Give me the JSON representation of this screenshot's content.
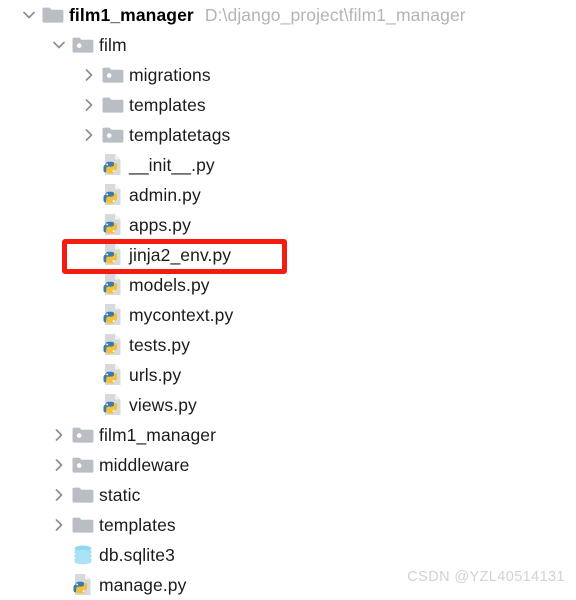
{
  "root": {
    "title": "film1_manager",
    "path": "D:\\django_project\\film1_manager"
  },
  "watermark": "CSDN @YZL40514131",
  "highlight": {
    "target": "jinja2_env.py",
    "color": "#f61b10"
  },
  "tree": [
    {
      "label": "film1_manager",
      "path": "D:\\django_project\\film1_manager",
      "icon": "folder-plain",
      "chevron": "chevron-down",
      "level": 0,
      "bold": true
    },
    {
      "label": "film",
      "icon": "folder-package",
      "chevron": "chevron-down",
      "level": 1,
      "bold": false
    },
    {
      "label": "migrations",
      "icon": "folder-package",
      "chevron": "chevron-right",
      "level": 2,
      "bold": false
    },
    {
      "label": "templates",
      "icon": "folder-plain",
      "chevron": "chevron-right",
      "level": 2,
      "bold": false
    },
    {
      "label": "templatetags",
      "icon": "folder-package",
      "chevron": "chevron-right",
      "level": 2,
      "bold": false
    },
    {
      "label": "__init__.py",
      "icon": "python-file",
      "chevron": "none",
      "level": 2,
      "bold": false
    },
    {
      "label": "admin.py",
      "icon": "python-file",
      "chevron": "none",
      "level": 2,
      "bold": false
    },
    {
      "label": "apps.py",
      "icon": "python-file",
      "chevron": "none",
      "level": 2,
      "bold": false
    },
    {
      "label": "jinja2_env.py",
      "icon": "python-file",
      "chevron": "none",
      "level": 2,
      "bold": false
    },
    {
      "label": "models.py",
      "icon": "python-file",
      "chevron": "none",
      "level": 2,
      "bold": false
    },
    {
      "label": "mycontext.py",
      "icon": "python-file",
      "chevron": "none",
      "level": 2,
      "bold": false
    },
    {
      "label": "tests.py",
      "icon": "python-file",
      "chevron": "none",
      "level": 2,
      "bold": false
    },
    {
      "label": "urls.py",
      "icon": "python-file",
      "chevron": "none",
      "level": 2,
      "bold": false
    },
    {
      "label": "views.py",
      "icon": "python-file",
      "chevron": "none",
      "level": 2,
      "bold": false
    },
    {
      "label": "film1_manager",
      "icon": "folder-package",
      "chevron": "chevron-right",
      "level": 1,
      "bold": false
    },
    {
      "label": "middleware",
      "icon": "folder-package",
      "chevron": "chevron-right",
      "level": 1,
      "bold": false
    },
    {
      "label": "static",
      "icon": "folder-plain",
      "chevron": "chevron-right",
      "level": 1,
      "bold": false
    },
    {
      "label": "templates",
      "icon": "folder-plain",
      "chevron": "chevron-right",
      "level": 1,
      "bold": false
    },
    {
      "label": "db.sqlite3",
      "icon": "database-file",
      "chevron": "none",
      "level": 1,
      "bold": false
    },
    {
      "label": "manage.py",
      "icon": "python-file",
      "chevron": "none",
      "level": 1,
      "bold": false
    }
  ]
}
